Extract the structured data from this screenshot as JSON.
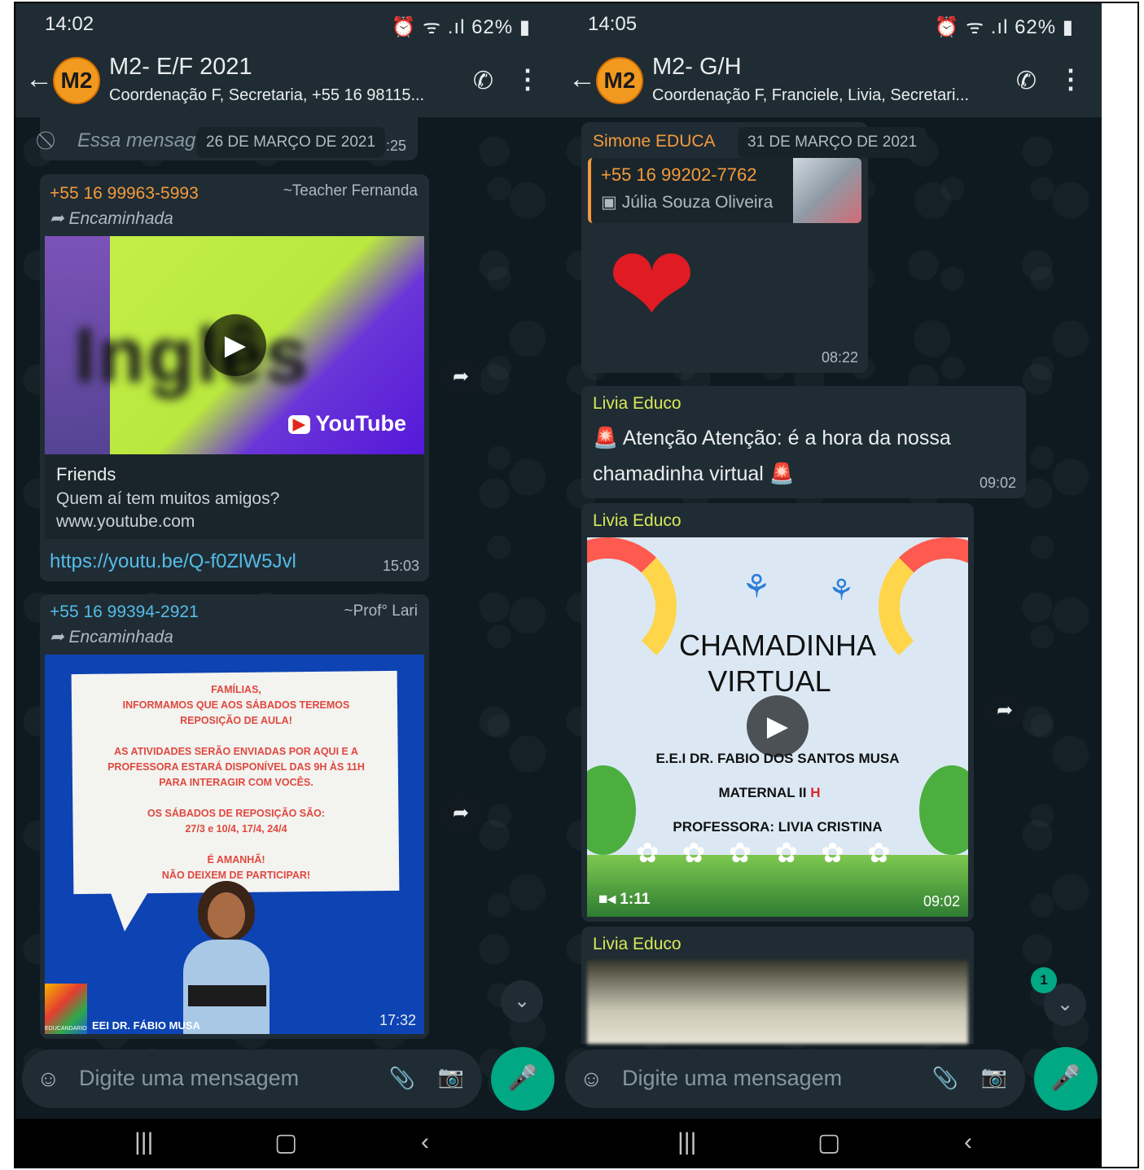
{
  "left": {
    "status": {
      "time": "14:02",
      "icons": "⏰ ᯤ .ıl 62% ▮"
    },
    "header": {
      "avatar": "M2",
      "title": "M2- E/F 2021",
      "subtitle": "Coordenação F, Secretaria, +55 16 98115..."
    },
    "top_partial": {
      "text": "Essa mensag",
      "time": ":25"
    },
    "date_chip": "26 DE MARÇO DE 2021",
    "msg1": {
      "sender": "+55 16 99963-5993",
      "alias": "~Teacher Fernanda",
      "forwarded": "Encaminhada",
      "video_word": "Inglês",
      "brand": "YouTube",
      "preview_title": "Friends",
      "preview_desc": "Quem aí tem muitos amigos?",
      "preview_domain": "www.youtube.com",
      "link": "https://youtu.be/Q-f0ZlW5Jvl",
      "time": "15:03"
    },
    "msg2": {
      "sender": "+55 16 99394-2921",
      "alias": "~Prof° Lari",
      "forwarded": "Encaminhada",
      "poster_lines": [
        "FAMÍLIAS,",
        "INFORMAMOS QUE AOS SÁBADOS TEREMOS",
        "REPOSIÇÃO DE AULA!",
        "",
        "AS ATIVIDADES SERÃO ENVIADAS POR AQUI E A",
        "PROFESSORA ESTARÁ DISPONÍVEL DAS 9H ÀS 11H",
        "PARA INTERAGIR COM VOCÊS.",
        "",
        "OS SÁBADOS DE REPOSIÇÃO SÃO:",
        "27/3 e 10/4, 17/4, 24/4",
        "",
        "É AMANHÃ!",
        "NÃO DEIXEM DE PARTICIPAR!"
      ],
      "school_label": "EEI DR. FÁBIO MUSA",
      "logo_text": "EDUCANDARIO",
      "time": "17:32"
    },
    "input_placeholder": "Digite uma mensagem"
  },
  "right": {
    "status": {
      "time": "14:05",
      "icons": "⏰ ᯤ .ıl 62% ▮"
    },
    "header": {
      "avatar": "M2",
      "title": "M2- G/H",
      "subtitle": "Coordenação F, Franciele, Livia, Secretari..."
    },
    "date_chip": "31 DE MARÇO DE 2021",
    "msg1": {
      "sender": "Simone EDUCA",
      "quote_sender": "+55 16 99202-7762",
      "quote_text": "Júlia Souza Oliveira",
      "emoji": "❤",
      "time": "08:22"
    },
    "msg2": {
      "sender": "Livia Educo",
      "text_a": "Atenção Atenção: é a hora da nossa",
      "text_b": "chamadinha virtual",
      "time": "09:02"
    },
    "msg3": {
      "sender": "Livia Educo",
      "title_a": "CHAMADINHA",
      "title_b": "VIRTUAL",
      "line1": "E.E.I DR. FABIO DOS SANTOS MUSA",
      "line2_a": "MATERNAL II ",
      "line2_b": "H",
      "line3": "PROFESSORA: LIVIA CRISTINA",
      "duration": "1:11",
      "time": "09:02"
    },
    "msg4": {
      "sender": "Livia Educo"
    },
    "unread_badge": "1",
    "input_placeholder": "Digite uma mensagem"
  },
  "colors": {
    "accent_green": "#00a884",
    "sender_left": "#53bdeb",
    "sender_orange": "#f49a3c",
    "sender_yellow": "#d7e85a"
  }
}
